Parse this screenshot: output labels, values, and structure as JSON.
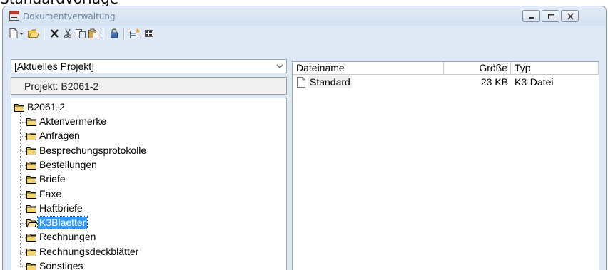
{
  "page_caption": "Standardvorlage",
  "window": {
    "title": "Dokumentverwaltung",
    "icon": "app-window-icon",
    "controls": [
      "minimize-icon",
      "maximize-icon",
      "close-icon"
    ]
  },
  "toolbar": {
    "icons": [
      "new-document-icon",
      "dropdown-arrow-icon",
      "open-folder-icon",
      "delete-icon",
      "cut-icon",
      "copy-icon",
      "paste-icon",
      "lock-icon",
      "properties-icon",
      "view-icon"
    ]
  },
  "left_pane": {
    "project_selector": "[Aktuelles Projekt]",
    "project_label": "Projekt: B2061-2",
    "tree": {
      "root": "B2061-2",
      "children": [
        "Aktenvermerke",
        "Anfragen",
        "Besprechungsprotokolle",
        "Bestellungen",
        "Briefe",
        "Faxe",
        "Haftbriefe",
        "K3Blaetter",
        "Rechnungen",
        "Rechnungsdeckblätter",
        "Sonstiges"
      ],
      "selected": "K3Blaetter"
    }
  },
  "file_list": {
    "columns": [
      "Dateiname",
      "Größe",
      "Typ"
    ],
    "rows": [
      {
        "name": "Standard",
        "size": "23 KB",
        "type": "K3-Datei"
      }
    ]
  },
  "colors": {
    "selection": "#3399ff",
    "folder": "#f4d56b",
    "title_text": "#6d84a0",
    "window_frame": "#dfe9f5"
  }
}
